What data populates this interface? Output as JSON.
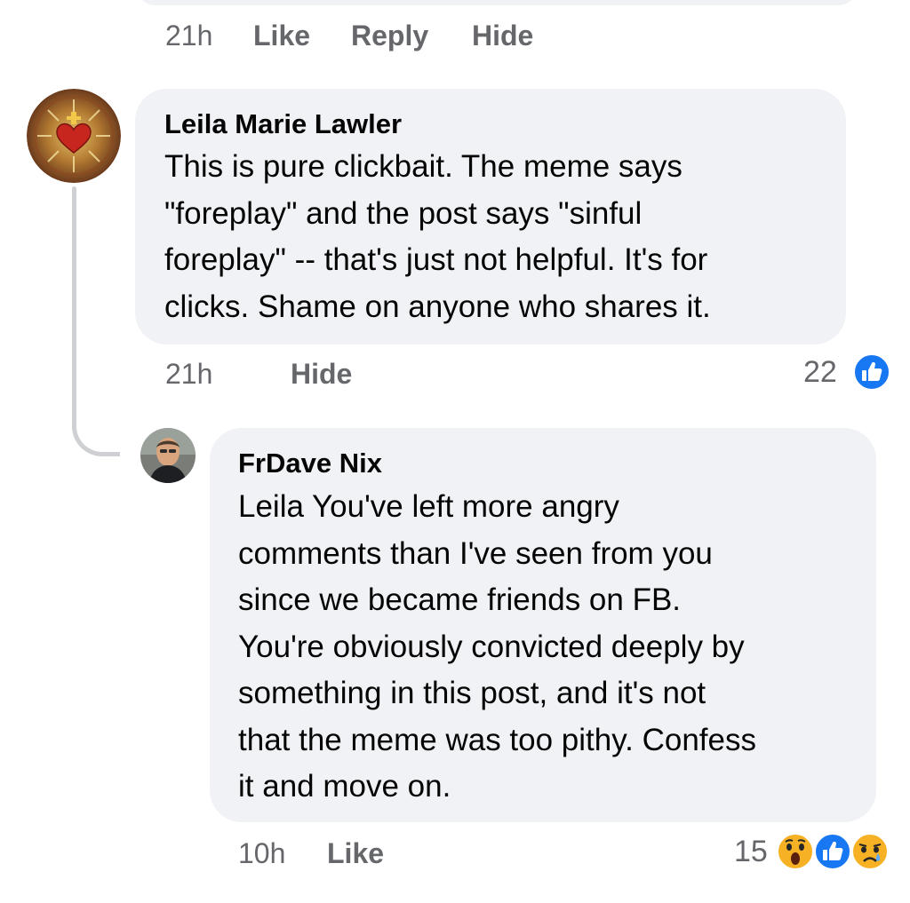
{
  "previous_comment": {
    "time": "21h",
    "like_label": "Like",
    "reply_label": "Reply",
    "hide_label": "Hide"
  },
  "comments": [
    {
      "author": "Leila Marie Lawler",
      "text": "This is pure clickbait. The meme says\n\"foreplay\" and the post says \"sinful\nforeplay\" -- that's just not helpful. It's for\nclicks. Shame on anyone who shares it.",
      "time": "21h",
      "hide_label": "Hide",
      "reaction_count": "22",
      "reactions": [
        "like-reaction-icon"
      ]
    },
    {
      "author": "FrDave Nix",
      "text": "Leila You've left more angry\ncomments than I've seen from you\nsince we became friends on FB.\nYou're obviously convicted deeply by\nsomething in this post, and it's not\nthat the meme was too pithy.  Confess\nit and move on.",
      "time": "10h",
      "like_label": "Like",
      "reaction_count": "15",
      "reactions": [
        "wow-reaction-icon",
        "like-reaction-icon",
        "sad-reaction-icon"
      ]
    }
  ],
  "colors": {
    "bubble": "#f0f2f5",
    "meta_text": "#65676b",
    "like_blue": "#1877f2",
    "reaction_yellow": "#f7b125"
  }
}
